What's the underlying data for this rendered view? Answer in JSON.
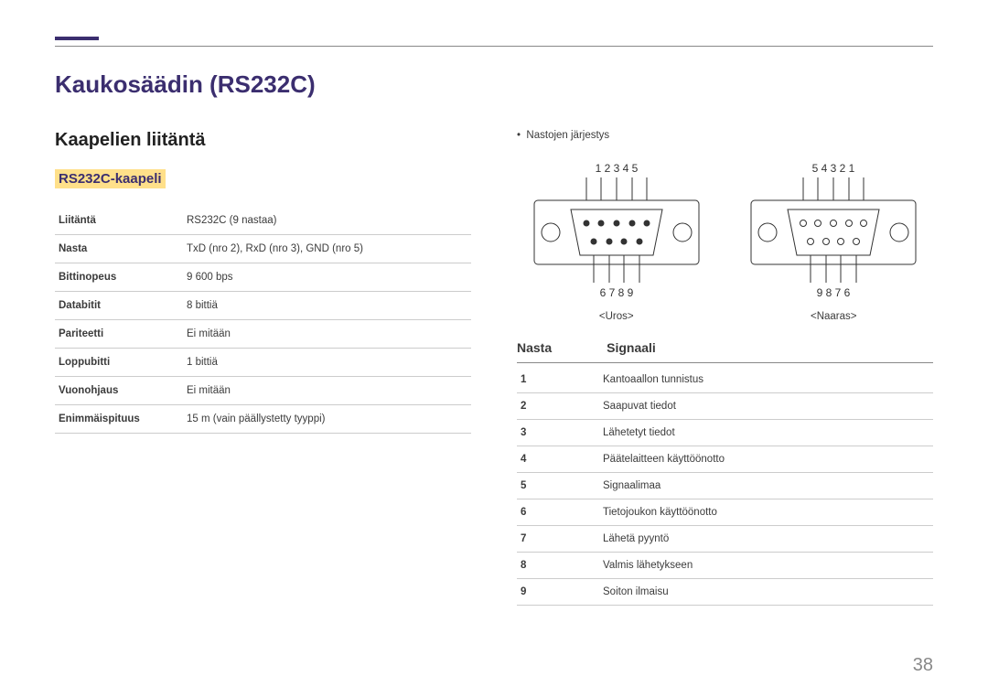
{
  "title": "Kaukosäädin (RS232C)",
  "subtitle": "Kaapelien liitäntä",
  "cable_heading": "RS232C-kaapeli",
  "spec_rows": [
    {
      "label": "Liitäntä",
      "value": "RS232C (9 nastaa)"
    },
    {
      "label": "Nasta",
      "value": "TxD (nro 2), RxD (nro 3), GND (nro 5)"
    },
    {
      "label": "Bittinopeus",
      "value": "9 600 bps"
    },
    {
      "label": "Databitit",
      "value": "8 bittiä"
    },
    {
      "label": "Pariteetti",
      "value": "Ei mitään"
    },
    {
      "label": "Loppubitti",
      "value": "1 bittiä"
    },
    {
      "label": "Vuonohjaus",
      "value": "Ei mitään"
    },
    {
      "label": "Enimmäispituus",
      "value": "15 m (vain päällystetty tyyppi)"
    }
  ],
  "pin_order_label": "Nastojen järjestys",
  "connectors": {
    "male": {
      "top_nums": "1   2   3   4   5",
      "bottom_nums": "6   7   8   9",
      "label": "<Uros>"
    },
    "female": {
      "top_nums": "5   4   3   2   1",
      "bottom_nums": "9   8   7   6",
      "label": "<Naaras>"
    }
  },
  "pin_table": {
    "head_pin": "Nasta",
    "head_sig": "Signaali",
    "rows": [
      {
        "n": "1",
        "s": "Kantoaallon tunnistus"
      },
      {
        "n": "2",
        "s": "Saapuvat tiedot"
      },
      {
        "n": "3",
        "s": "Lähetetyt tiedot"
      },
      {
        "n": "4",
        "s": "Päätelaitteen käyttöönotto"
      },
      {
        "n": "5",
        "s": "Signaalimaa"
      },
      {
        "n": "6",
        "s": "Tietojoukon käyttöönotto"
      },
      {
        "n": "7",
        "s": "Lähetä pyyntö"
      },
      {
        "n": "8",
        "s": "Valmis lähetykseen"
      },
      {
        "n": "9",
        "s": "Soiton ilmaisu"
      }
    ]
  },
  "page_number": "38"
}
